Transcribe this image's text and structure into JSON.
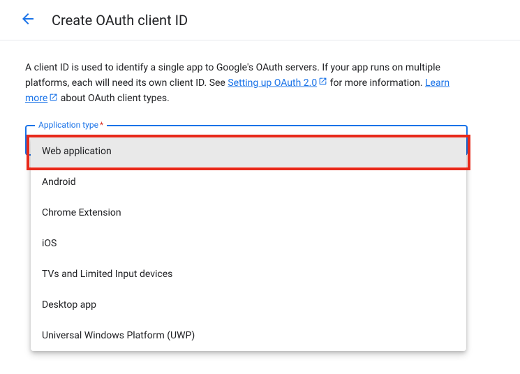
{
  "header": {
    "title": "Create OAuth client ID"
  },
  "description": {
    "text1": "A client ID is used to identify a single app to Google's OAuth servers. If your app runs on multiple platforms, each will need its own client ID. See ",
    "link1": "Setting up OAuth 2.0",
    "text2": " for more information. ",
    "link2": "Learn more",
    "text3": " about OAuth client types."
  },
  "field": {
    "label": "Application type",
    "required_marker": "*"
  },
  "options": [
    {
      "label": "Web application",
      "selected": true
    },
    {
      "label": "Android",
      "selected": false
    },
    {
      "label": "Chrome Extension",
      "selected": false
    },
    {
      "label": "iOS",
      "selected": false
    },
    {
      "label": "TVs and Limited Input devices",
      "selected": false
    },
    {
      "label": "Desktop app",
      "selected": false
    },
    {
      "label": "Universal Windows Platform (UWP)",
      "selected": false
    }
  ]
}
